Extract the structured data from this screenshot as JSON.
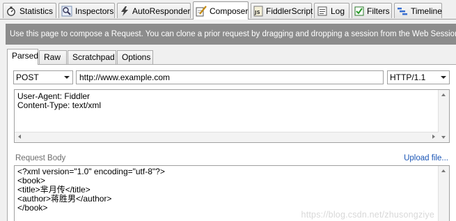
{
  "top_tabs": [
    {
      "label": "Statistics",
      "icon": "stopwatch-icon"
    },
    {
      "label": "Inspectors",
      "icon": "magnifier-icon"
    },
    {
      "label": "AutoResponder",
      "icon": "lightning-icon"
    },
    {
      "label": "Composer",
      "icon": "pencil-paper-icon",
      "active": true
    },
    {
      "label": "FiddlerScript",
      "icon": "script-file-icon"
    },
    {
      "label": "Log",
      "icon": "log-icon"
    },
    {
      "label": "Filters",
      "icon": "checkbox-icon"
    },
    {
      "label": "Timeline",
      "icon": "timeline-icon"
    }
  ],
  "info_text": "Use this page to compose a Request. You can clone a prior request by dragging and dropping a session from the Web Sessions",
  "inner_tabs": [
    {
      "label": "Parsed",
      "active": true
    },
    {
      "label": "Raw"
    },
    {
      "label": "Scratchpad"
    },
    {
      "label": "Options"
    }
  ],
  "request": {
    "method": "POST",
    "url": "http://www.example.com",
    "version": "HTTP/1.1"
  },
  "headers_text": "User-Agent: Fiddler\nContent-Type: text/xml",
  "request_body_label": "Request Body",
  "upload_label": "Upload file...",
  "body_text": "<?xml version=\"1.0\" encoding=\"utf-8\"?>\n<book>\n<title>芈月传</title>\n<author>蒋胜男</author>\n</book>",
  "watermark": "https://blog.csdn.net/zhusongziye"
}
